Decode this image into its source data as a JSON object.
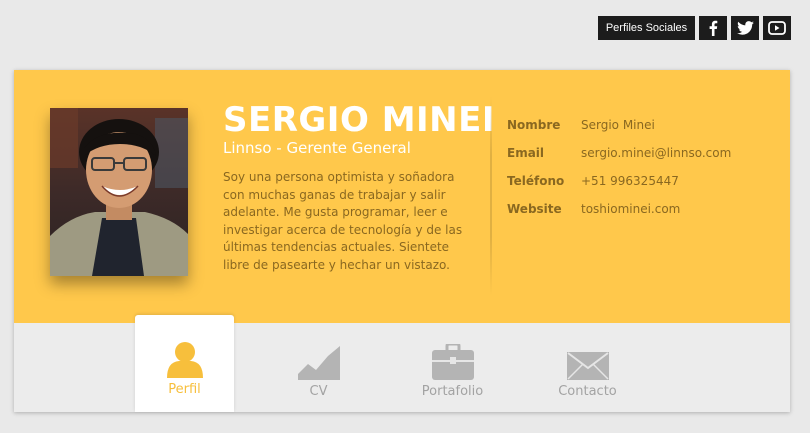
{
  "social": {
    "label": "Perfiles Sociales",
    "icons": [
      "facebook-icon",
      "twitter-icon",
      "youtube-icon"
    ]
  },
  "profile": {
    "name": "SERGIO MINEI",
    "role": "Linnso - Gerente General",
    "bio": "Soy una persona optimista y soñadora con muchas ganas de trabajar y salir adelante. Me gusta programar, leer e investigar acerca de tecnología y de las últimas tendencias actuales. Sientete libre de pasearte y hechar un vistazo."
  },
  "info": [
    {
      "key": "Nombre",
      "value": "Sergio Minei"
    },
    {
      "key": "Email",
      "value": "sergio.minei@linnso.com"
    },
    {
      "key": "Teléfono",
      "value": "+51 996325447"
    },
    {
      "key": "Website",
      "value": "toshiominei.com"
    }
  ],
  "tabs": [
    {
      "label": "Perfil",
      "icon": "user-icon",
      "active": true
    },
    {
      "label": "CV",
      "icon": "chart-icon",
      "active": false
    },
    {
      "label": "Portafolio",
      "icon": "briefcase-icon",
      "active": false
    },
    {
      "label": "Contacto",
      "icon": "mail-icon",
      "active": false
    }
  ],
  "colors": {
    "accent": "#ffc84b",
    "accent_dark": "#8a6820",
    "tab_active": "#f7bf3c",
    "tab_inactive": "#a3a3a3",
    "social_bg": "#1c1c1c"
  }
}
